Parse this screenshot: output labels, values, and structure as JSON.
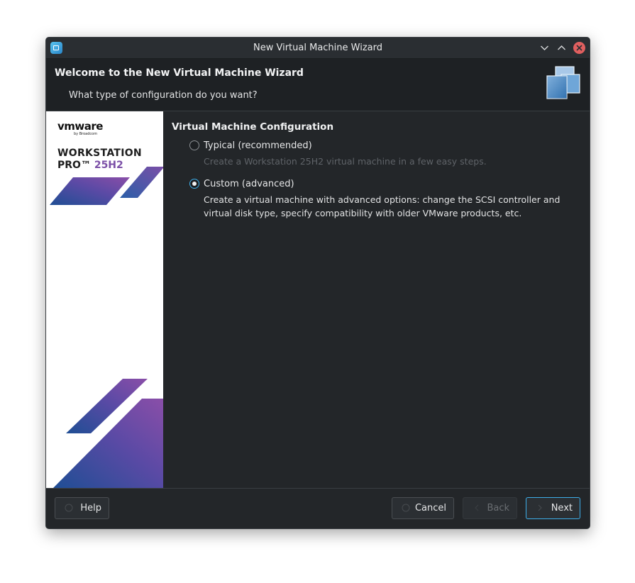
{
  "window": {
    "title": "New Virtual Machine Wizard"
  },
  "titlebar_controls": {
    "minimize": "⌄",
    "maximize": "⌃",
    "close": "✕"
  },
  "header": {
    "title": "Welcome to the New Virtual Machine Wizard",
    "subtitle": "What type of configuration do you want?"
  },
  "brand": {
    "vmware": "vmware",
    "by": "by Broadcom",
    "product_line1": "WORKSTATION",
    "product_pro": "PRO™",
    "product_version": "25H2"
  },
  "config": {
    "section_title": "Virtual Machine Configuration",
    "options": [
      {
        "label": "Typical (recommended)",
        "description": "Create a Workstation 25H2 virtual machine in a few easy steps.",
        "selected": false
      },
      {
        "label": "Custom (advanced)",
        "description": "Create a virtual machine with advanced options: change the SCSI controller and virtual disk type, specify compatibility with older VMware products, etc.",
        "selected": true
      }
    ]
  },
  "footer": {
    "help": "Help",
    "cancel": "Cancel",
    "back": "Back",
    "next": "Next"
  },
  "colors": {
    "accent": "#3daee9",
    "brand_purple": "#7b4fa7",
    "window_bg": "#232629"
  }
}
